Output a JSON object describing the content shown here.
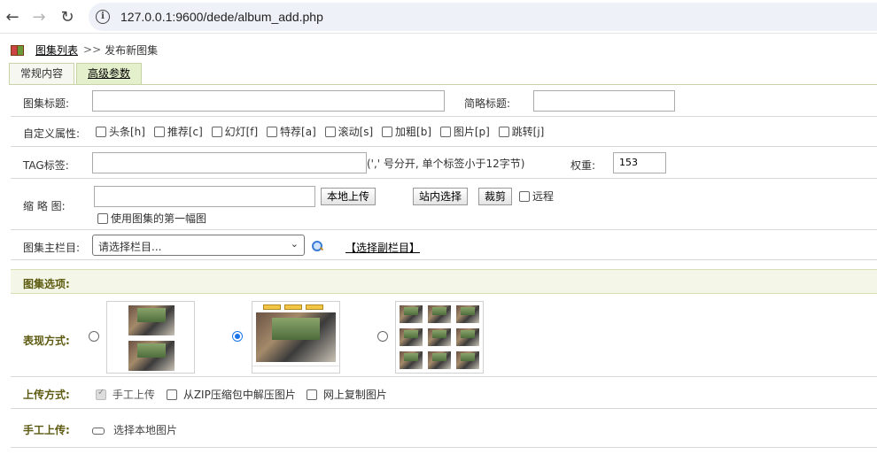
{
  "browser": {
    "url": "127.0.0.1:9600/dede/album_add.php",
    "back_icon": "←",
    "forward_icon": "→",
    "reload_icon": "↻",
    "info_icon": "i"
  },
  "breadcrumb": {
    "link": "图集列表",
    "separator": ">>",
    "current": "发布新图集"
  },
  "tabs": [
    {
      "label": "常规内容",
      "active": false
    },
    {
      "label": "高级参数",
      "active": true
    }
  ],
  "form": {
    "title_label": "图集标题:",
    "title_value": "",
    "short_title_label": "简略标题:",
    "short_title_value": "",
    "attr_label": "自定义属性:",
    "attributes": [
      {
        "label": "头条[h]"
      },
      {
        "label": "推荐[c]"
      },
      {
        "label": "幻灯[f]"
      },
      {
        "label": "特荐[a]"
      },
      {
        "label": "滚动[s]"
      },
      {
        "label": "加粗[b]"
      },
      {
        "label": "图片[p]"
      },
      {
        "label": "跳转[j]"
      }
    ],
    "tag_label": "TAG标签:",
    "tag_value": "",
    "tag_hint": "(',' 号分开, 单个标签小于12字节)",
    "weight_label": "权重:",
    "weight_value": "153",
    "thumb_label": "缩 略 图:",
    "thumb_value": "",
    "local_upload": "本地上传",
    "site_select": "站内选择",
    "crop": "裁剪",
    "remote": "远程",
    "use_first": "使用图集的第一幅图",
    "column_label": "图集主栏目:",
    "column_select": "请选择栏目...",
    "select_sub": "【选择副栏目】",
    "options_header": "图集选项:",
    "display_label": "表现方式:",
    "display_selected_index": 1,
    "upload_label": "上传方式:",
    "upload_options": [
      {
        "label": "手工上传"
      },
      {
        "label": "从ZIP压缩包中解压图片"
      },
      {
        "label": "网上复制图片"
      }
    ],
    "manual_label": "手工上传:",
    "choose_local": "选择本地图片"
  }
}
